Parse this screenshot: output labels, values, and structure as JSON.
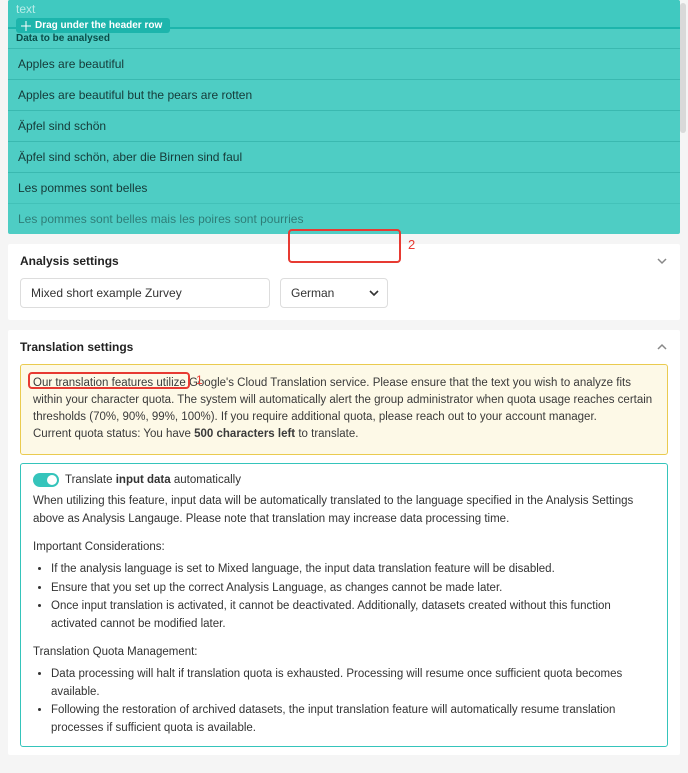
{
  "table": {
    "header": "text",
    "drag_hint": "Drag under the header row",
    "sub_header": "Data to be analysed",
    "rows": [
      "Apples are beautiful",
      "Apples are beautiful but the pears are rotten",
      "Äpfel sind schön",
      "Äpfel sind schön, aber die Birnen sind faul",
      "Les pommes sont belles",
      "Les pommes sont belles mais les poires sont pourries"
    ]
  },
  "analysis": {
    "title": "Analysis settings",
    "name_value": "Mixed short example Zurvey",
    "language_value": "German",
    "callout": "2"
  },
  "translation": {
    "title": "Translation settings",
    "callout": "1",
    "warning": {
      "p1": "Our translation features utilize Google's Cloud Translation service. Please ensure that the text you wish to analyze fits within your character quota. The system will automatically alert the group administrator when quota usage reaches certain thresholds (70%, 90%, 99%, 100%). If you require additional quota, please reach out to your account manager.",
      "quota_prefix": "Current quota status: You have ",
      "quota_bold": "500 characters left",
      "quota_suffix": " to translate."
    },
    "toggle": {
      "prefix": "Translate ",
      "bold": "input data",
      "suffix": " automatically"
    },
    "desc": "When utilizing this feature, input data will be automatically translated to the language specified in the Analysis Settings above as Analysis Langauge. Please note that translation may increase data processing time.",
    "considerations_title": "Important Considerations:",
    "considerations": [
      "If the analysis language is set to Mixed language, the input data translation feature will be disabled.",
      "Ensure that you set up the correct Analysis Language, as changes cannot be made later.",
      "Once input translation is activated, it cannot be deactivated. Additionally, datasets created without this function activated cannot be modified later."
    ],
    "quota_mgmt_title": "Translation Quota Management:",
    "quota_mgmt": [
      "Data processing will halt if translation quota is exhausted. Processing will resume once sufficient quota becomes available.",
      "Following the restoration of archived datasets, the input translation feature will automatically resume translation processes if sufficient quota is available."
    ]
  }
}
